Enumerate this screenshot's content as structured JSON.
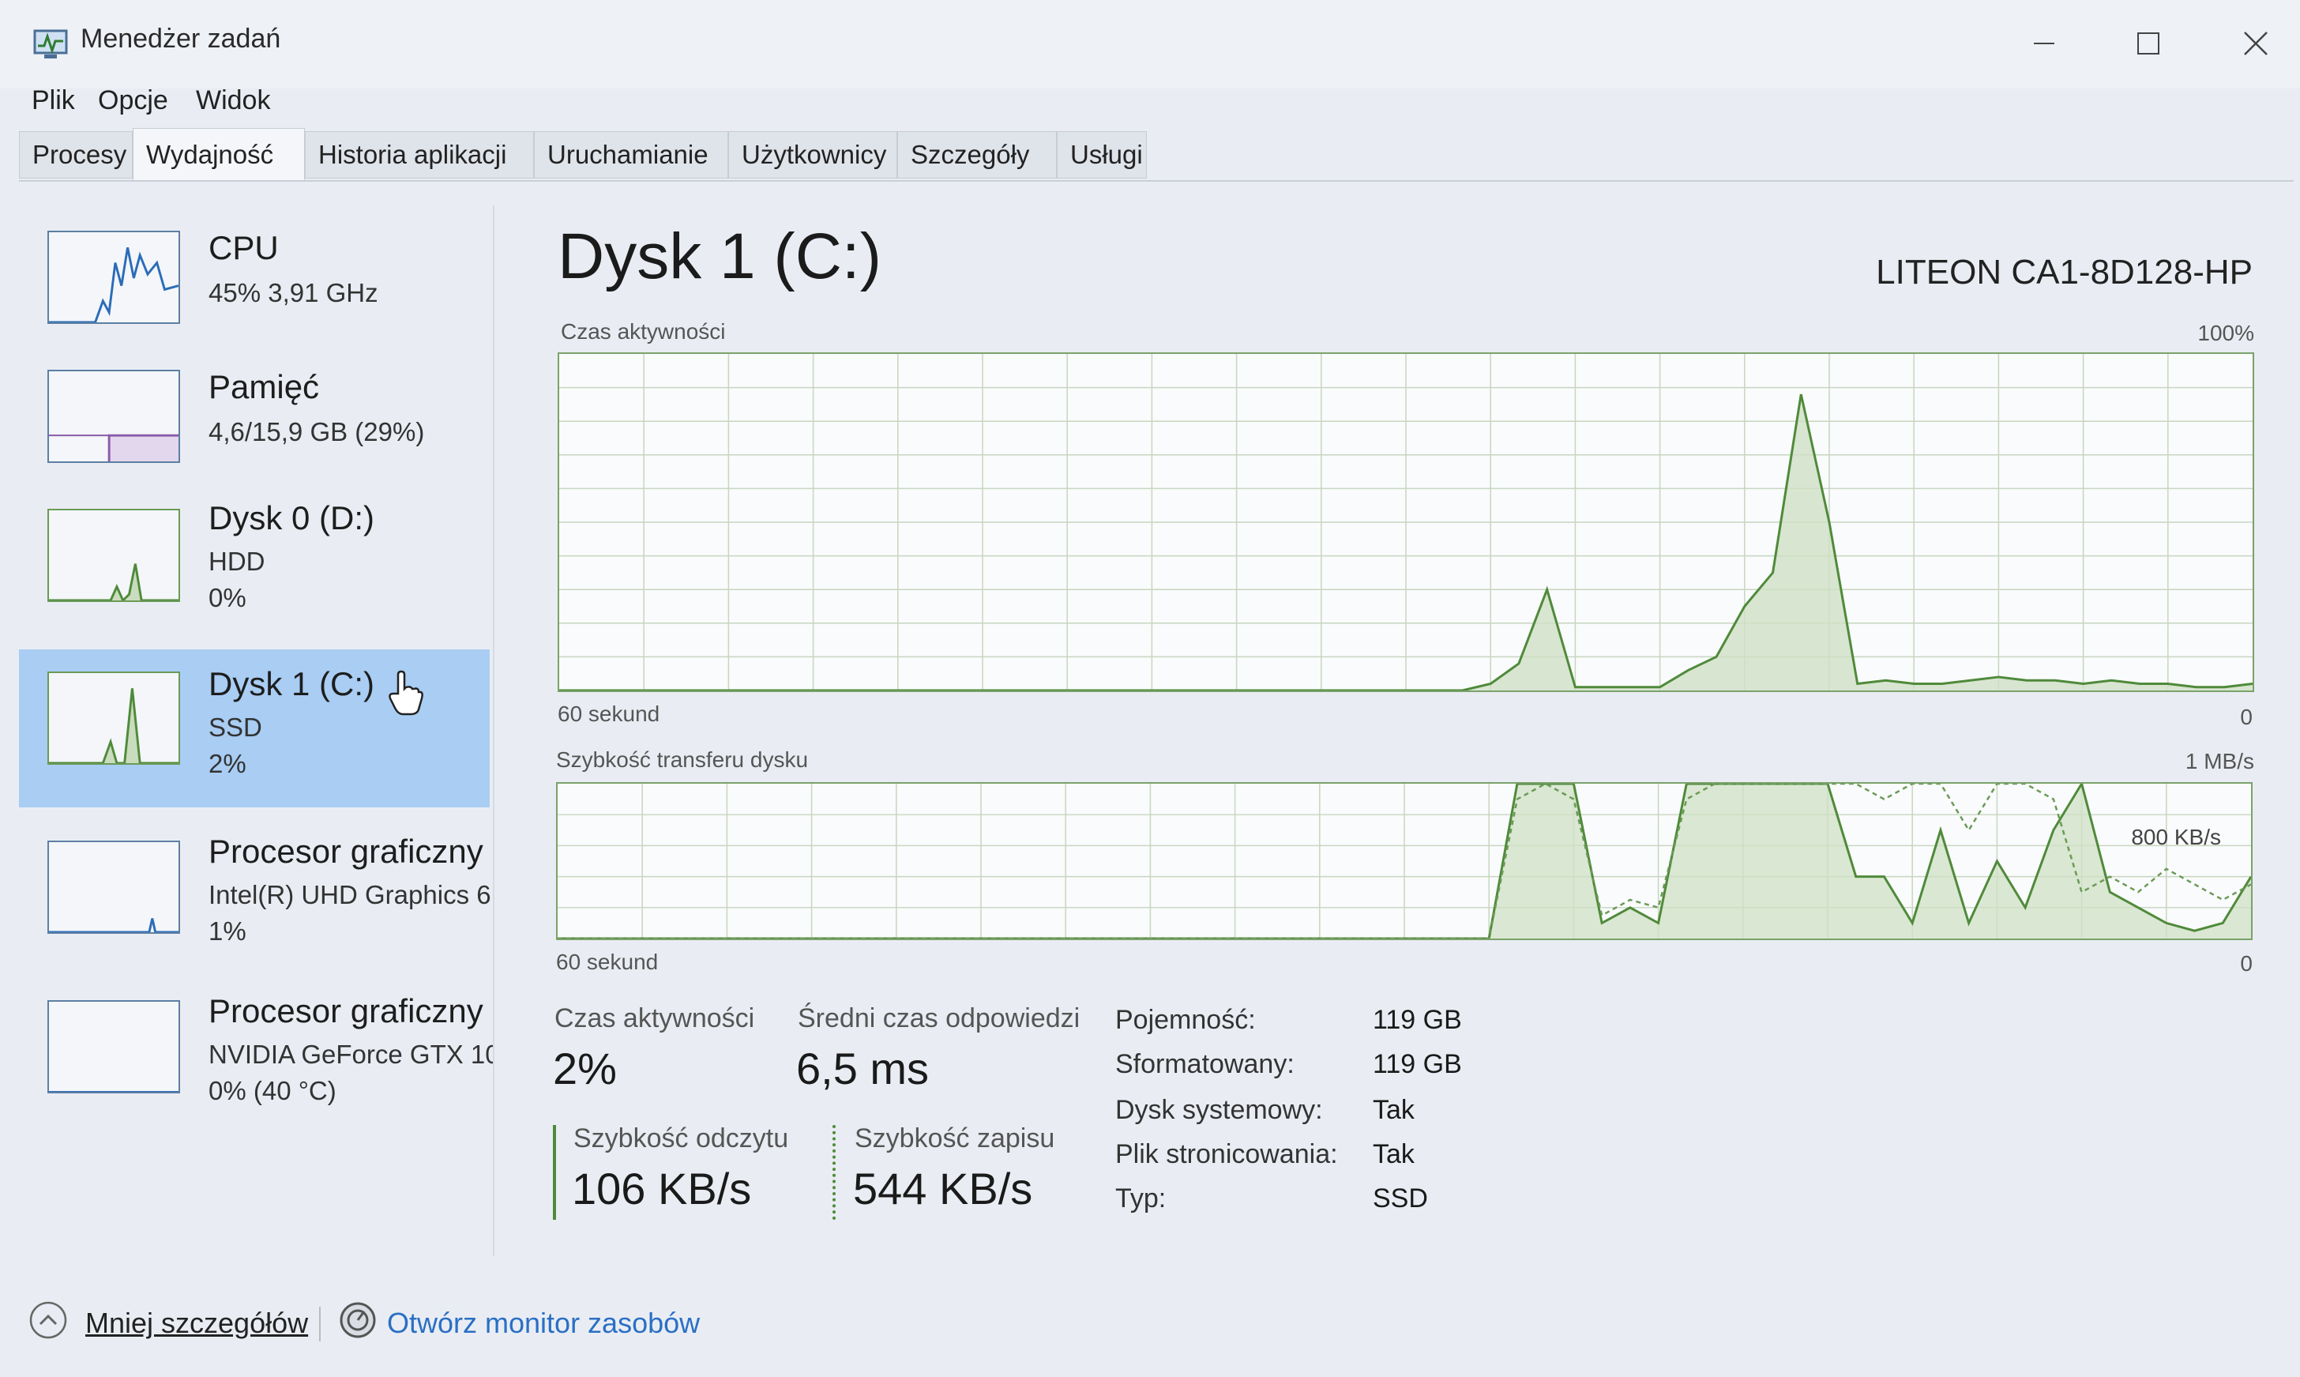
{
  "window": {
    "title": "Menedżer zadań"
  },
  "menu": [
    "Plik",
    "Opcje",
    "Widok"
  ],
  "tabs": [
    "Procesy",
    "Wydajność",
    "Historia aplikacji",
    "Uruchamianie",
    "Użytkownicy",
    "Szczegóły",
    "Usługi"
  ],
  "sidebar": {
    "items": [
      {
        "title": "CPU",
        "line1": "45% 3,91 GHz",
        "line2": ""
      },
      {
        "title": "Pamięć",
        "line1": "4,6/15,9 GB (29%)",
        "line2": ""
      },
      {
        "title": "Dysk 0 (D:)",
        "line1": "HDD",
        "line2": "0%"
      },
      {
        "title": "Dysk 1 (C:)",
        "line1": "SSD",
        "line2": "2%"
      },
      {
        "title": "Procesor graficzny",
        "line1": "Intel(R) UHD Graphics 6",
        "line2": "1%"
      },
      {
        "title": "Procesor graficzny",
        "line1": "NVIDIA GeForce GTX 10",
        "line2": "0% (40 °C)"
      }
    ]
  },
  "main": {
    "title": "Dysk 1 (C:)",
    "device": "LITEON CA1-8D128-HP",
    "graph1": {
      "label": "Czas aktywności",
      "max": "100%",
      "x_left": "60 sekund",
      "x_right": "0"
    },
    "graph2": {
      "label": "Szybkość transferu dysku",
      "max": "1 MB/s",
      "mid": "800 KB/s",
      "x_left": "60 sekund",
      "x_right": "0"
    },
    "stats": {
      "active_label": "Czas aktywności",
      "active_value": "2%",
      "response_label": "Średni czas odpowiedzi",
      "response_value": "6,5 ms",
      "read_label": "Szybkość odczytu",
      "read_value": "106 KB/s",
      "write_label": "Szybkość zapisu",
      "write_value": "544 KB/s"
    },
    "props": [
      {
        "label": "Pojemność:",
        "value": "119 GB"
      },
      {
        "label": "Sformatowany:",
        "value": "119 GB"
      },
      {
        "label": "Dysk systemowy:",
        "value": "Tak"
      },
      {
        "label": "Plik stronicowania:",
        "value": "Tak"
      },
      {
        "label": "Typ:",
        "value": "SSD"
      }
    ]
  },
  "footer": {
    "less_details": "Mniej szczegółów",
    "open_monitor": "Otwórz monitor zasobów"
  },
  "chart_data": [
    {
      "type": "area",
      "title": "Czas aktywności",
      "x": [
        60,
        57,
        54,
        51,
        48,
        45,
        42,
        39,
        36,
        35,
        34,
        33,
        32,
        31,
        30,
        29,
        28,
        27,
        26,
        25,
        24,
        23,
        22,
        21,
        20,
        19,
        18,
        17,
        16,
        15,
        14,
        13,
        12,
        11,
        10,
        9,
        8,
        7,
        6,
        5,
        4,
        3,
        2,
        1,
        0
      ],
      "y_percent": [
        0,
        0,
        0,
        0,
        0,
        0,
        0,
        0,
        0,
        0,
        0,
        0,
        0,
        0,
        0,
        0,
        0,
        2,
        8,
        30,
        1,
        1,
        1,
        1,
        6,
        10,
        25,
        35,
        88,
        50,
        2,
        3,
        2,
        2,
        3,
        4,
        3,
        3,
        2,
        3,
        2,
        2,
        1,
        1,
        2
      ],
      "ylim": [
        0,
        100
      ],
      "xlabel": "60 sekund",
      "grid": true
    },
    {
      "type": "line",
      "title": "Szybkość transferu dysku",
      "x": [
        60,
        57,
        54,
        51,
        48,
        45,
        42,
        39,
        36,
        35,
        34,
        33,
        32,
        31,
        30,
        29,
        28,
        27,
        26,
        25,
        24,
        23,
        22,
        21,
        20,
        19,
        18,
        17,
        16,
        15,
        14,
        13,
        12,
        11,
        10,
        9,
        8,
        7,
        6,
        5,
        4,
        3,
        2,
        1,
        0
      ],
      "series": [
        {
          "values_kb": [
            0,
            0,
            0,
            0,
            0,
            0,
            0,
            0,
            0,
            0,
            0,
            0,
            0,
            0,
            0,
            0,
            0,
            0,
            1000,
            1000,
            1000,
            100,
            200,
            100,
            1000,
            1000,
            1000,
            1000,
            1000,
            1000,
            400,
            400,
            100,
            700,
            100,
            500,
            200,
            700,
            1000,
            300,
            200,
            100,
            50,
            100,
            400
          ]
        },
        {
          "values_kb": [
            0,
            0,
            0,
            0,
            0,
            0,
            0,
            0,
            0,
            0,
            0,
            0,
            0,
            0,
            0,
            0,
            0,
            0,
            900,
            1000,
            900,
            150,
            250,
            200,
            900,
            1000,
            1000,
            1000,
            1000,
            1000,
            1000,
            900,
            1000,
            1000,
            700,
            1000,
            1000,
            900,
            300,
            400,
            300,
            450,
            350,
            250,
            350
          ]
        }
      ],
      "ylim_kb": [
        0,
        1000
      ],
      "xlabel": "60 sekund",
      "grid": true
    }
  ]
}
